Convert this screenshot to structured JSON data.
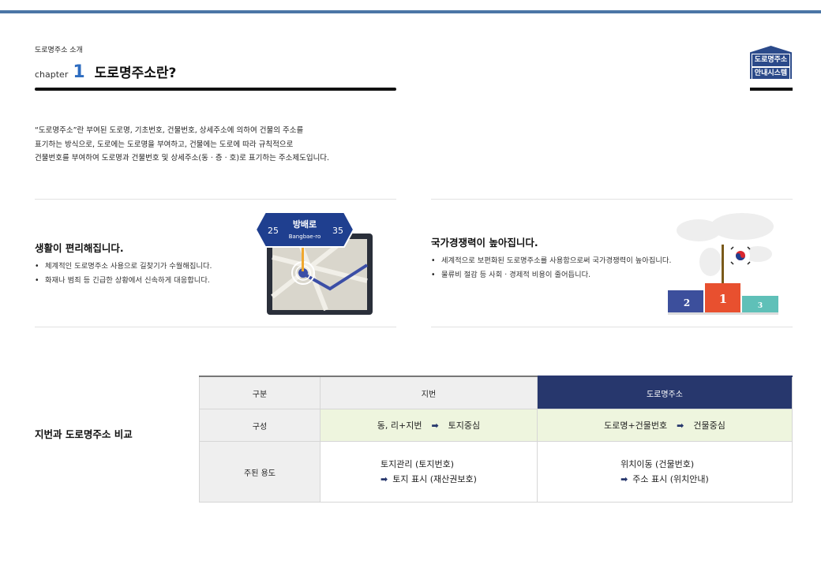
{
  "header": {
    "breadcrumb": "도로명주소 소개",
    "chapter_label": "chapter",
    "chapter_number": "1",
    "page_title": "도로명주소란?"
  },
  "logo": {
    "line1": "도로명주소",
    "line2": "안내시스템"
  },
  "intro": {
    "line1": "“도로명주소”란 부여된 도로명, 기초번호, 건물번호, 상세주소에 의하여 건물의 주소를",
    "line2": "표기하는 방식으로, 도로에는 도로명을 부여하고, 건물에는 도로에 따라 규칙적으로",
    "line3": "건물번호를 부여하여 도로명과 건물번호 및 상세주소(동 · 층 · 호)로 표기하는 주소제도입니다."
  },
  "features": [
    {
      "title": "생활이 편리해집니다.",
      "bullets": [
        "체계적인 도로명주소 사용으로 길찾기가 수월해집니다.",
        "화재나 범죄 등 긴급한 상황에서 신속하게 대응합니다."
      ],
      "sign": {
        "road": "방배로",
        "road_en": "Bangbae-ro",
        "left_num": "25",
        "right_num": "35"
      }
    },
    {
      "title": "국가경쟁력이 높아집니다.",
      "bullets": [
        "세계적으로 보편화된 도로명주소를 사용함으로써 국가경쟁력이 높아집니다.",
        "물류비 절감 등 사회 · 경제적 비용이 줄어듭니다."
      ],
      "podium": [
        "2",
        "1",
        "3"
      ]
    }
  ],
  "comparison": {
    "title": "지번과 도로명주소 비교",
    "headers": [
      "구분",
      "지번",
      "도로명주소"
    ],
    "row_composition": {
      "label": "구성",
      "jibun_a": "동, 리+지번",
      "jibun_b": "토지중심",
      "road_a": "도로명+건물번호",
      "road_b": "건물중심"
    },
    "row_usage": {
      "label": "주된 용도",
      "jibun_a": "토지관리 (토지번호)",
      "jibun_b": "토지 표시 (재산권보호)",
      "road_a": "위치이동 (건물번호)",
      "road_b": "주소 표시 (위치안내)"
    },
    "arrow": "➡"
  },
  "colors": {
    "accent_blue": "#2d6cc0",
    "navy": "#27376d",
    "top_bar": "#4b76a6",
    "green_row": "#eef5de"
  }
}
